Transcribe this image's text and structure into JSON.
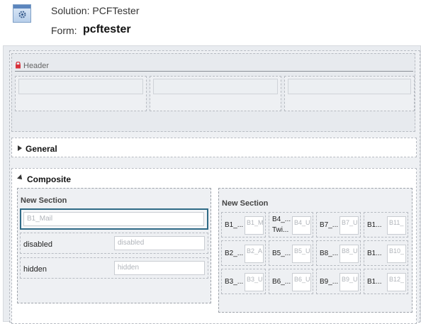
{
  "topbar": {
    "solution_label": "Solution: PCFTester",
    "form_label": "Form:",
    "form_name": "pcftester"
  },
  "header": {
    "label": "Header"
  },
  "tabs": {
    "general": {
      "label": "General"
    },
    "composite": {
      "label": "Composite"
    }
  },
  "section_left": {
    "label": "New Section",
    "fields": [
      {
        "label": "",
        "placeholder": "B1_Mail"
      },
      {
        "label": "disabled",
        "placeholder": "disabled"
      },
      {
        "label": "hidden",
        "placeholder": "hidden"
      }
    ]
  },
  "section_right": {
    "label": "New Section",
    "cells": [
      {
        "label": "B1_...",
        "placeholder": "B1_M",
        "extra": ""
      },
      {
        "label": "B4_...",
        "placeholder": "B4_U",
        "extra": "Twi..."
      },
      {
        "label": "B7_...",
        "placeholder": "B7_U",
        "extra": ""
      },
      {
        "label": "B1...",
        "placeholder": "B11_",
        "extra": ""
      },
      {
        "label": "B2_...",
        "placeholder": "B2_A",
        "extra": ""
      },
      {
        "label": "B5_...",
        "placeholder": "B5_U",
        "extra": ""
      },
      {
        "label": "B8_...",
        "placeholder": "B8_U",
        "extra": ""
      },
      {
        "label": "B1...",
        "placeholder": "B10_",
        "extra": ""
      },
      {
        "label": "B3_...",
        "placeholder": "B3_U",
        "extra": ""
      },
      {
        "label": "B6_...",
        "placeholder": "B6_U",
        "extra": ""
      },
      {
        "label": "B9_...",
        "placeholder": "B9_U",
        "extra": ""
      },
      {
        "label": "B1...",
        "placeholder": "B12_",
        "extra": ""
      }
    ]
  },
  "icons": {
    "app": "gear-window-icon",
    "lock": "lock-icon",
    "collapse_general": "triangle-right-icon",
    "collapse_composite": "triangle-down-icon"
  },
  "colors": {
    "accent": "#2f6a86",
    "lock": "#d9323b"
  }
}
